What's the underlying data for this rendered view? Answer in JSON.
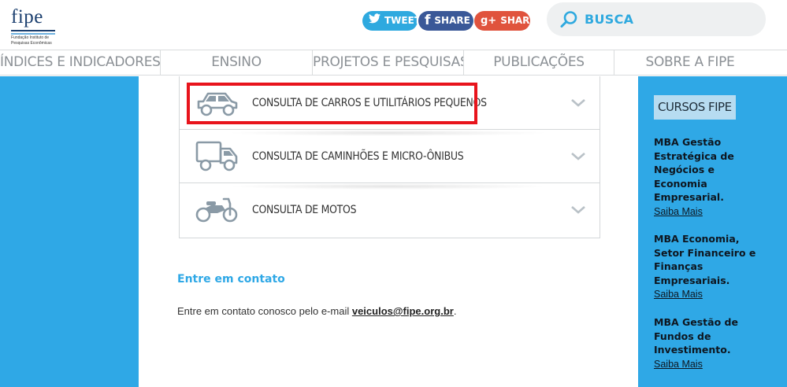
{
  "logo": {
    "word": "fipe",
    "sub_line1": "Fundação Instituto de",
    "sub_line2": "Pesquisas Econômicas"
  },
  "social": {
    "tweet_label": "TWEET",
    "facebook_label": "SHARE",
    "google_label": "SHARE",
    "google_icon": "g+",
    "colors": {
      "tweet": "#2ea9df",
      "facebook": "#3a5898",
      "google": "#e0533d"
    }
  },
  "search": {
    "label": "BUSCA",
    "icon": "search-icon"
  },
  "nav": {
    "items": [
      {
        "label": "ÍNDICES E INDICADORES"
      },
      {
        "label": "ENSINO"
      },
      {
        "label": "PROJETOS E PESQUISAS"
      },
      {
        "label": "PUBLICAÇÕES"
      },
      {
        "label": "SOBRE A FIPE"
      }
    ]
  },
  "vehicles": {
    "items": [
      {
        "label": "CONSULTA DE CARROS E UTILITÁRIOS PEQUENOS",
        "icon": "car-icon"
      },
      {
        "label": "CONSULTA DE CAMINHÕES E MICRO-ÔNIBUS",
        "icon": "truck-icon"
      },
      {
        "label": "CONSULTA DE MOTOS",
        "icon": "motorcycle-icon"
      }
    ]
  },
  "contact": {
    "title": "Entre em contato",
    "text": "Entre em contato conosco pelo e-mail ",
    "email": "veiculos@fipe.org.br",
    "end": "."
  },
  "sidebar": {
    "title": "CURSOS FIPE",
    "courses": [
      {
        "title": "MBA Gestão Estratégica de Negócios e Economia Empresarial.",
        "link": "Saiba Mais"
      },
      {
        "title": "MBA Economia, Setor Financeiro e Finanças Empresariais.",
        "link": "Saiba Mais"
      },
      {
        "title": "MBA Gestão de Fundos de Investimento.",
        "link": "Saiba Mais"
      }
    ]
  },
  "colors": {
    "accent_blue": "#2fa8e6",
    "highlight_red": "#e8141c",
    "nav_text": "#8b9095"
  }
}
